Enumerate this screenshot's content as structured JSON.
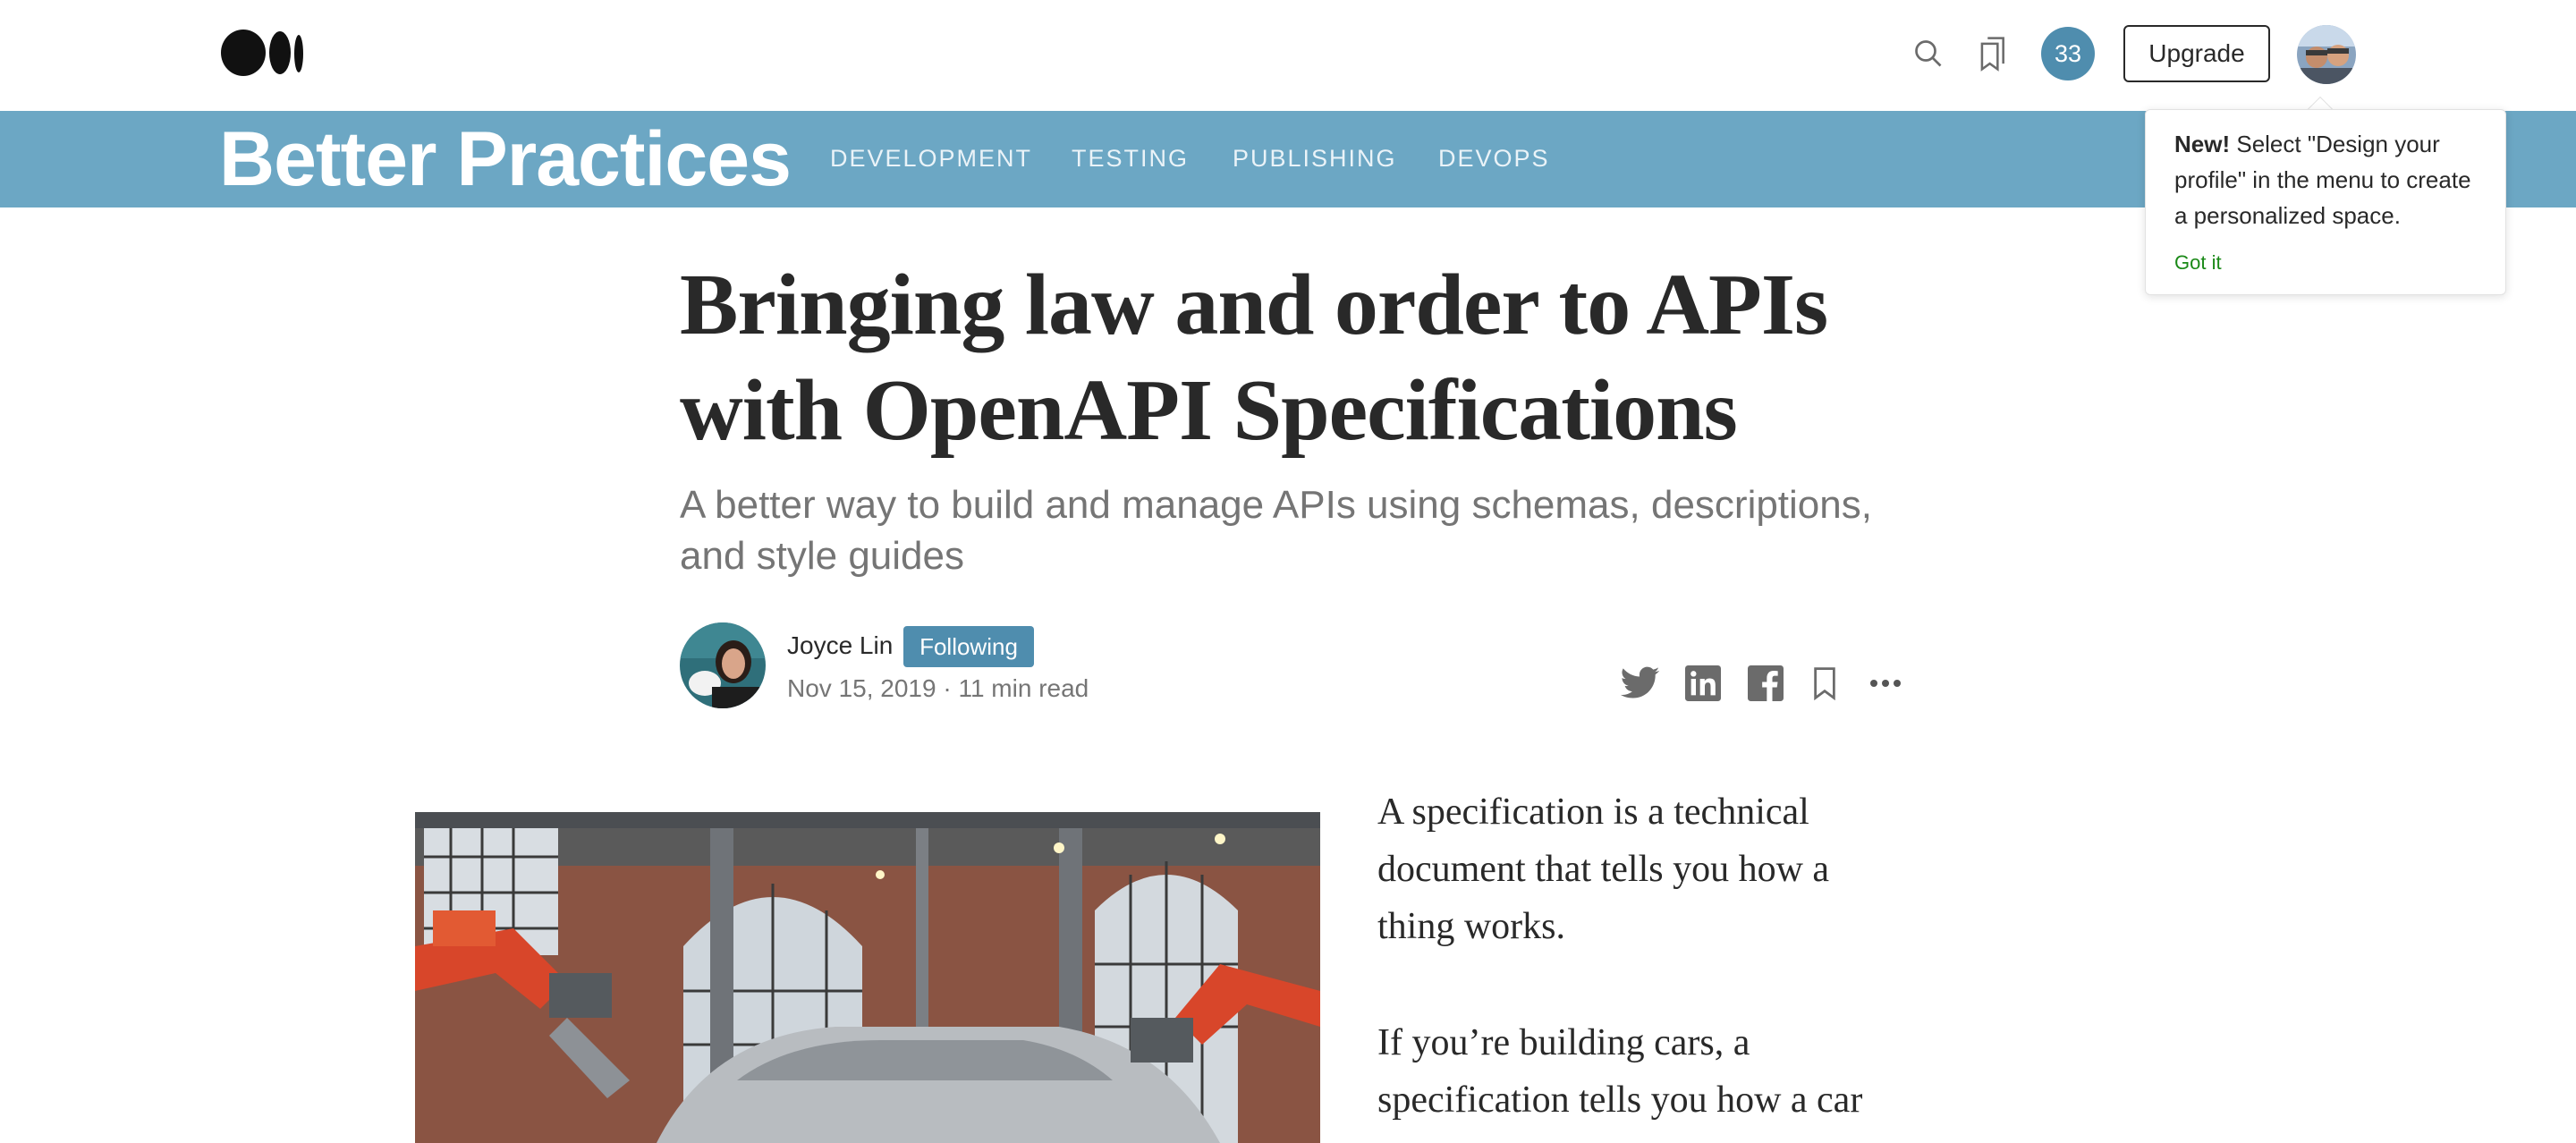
{
  "topbar": {
    "logo": "medium-logo",
    "search_icon": "search-icon",
    "lists_icon": "bookmarks-icon",
    "notification_count": "33",
    "upgrade_label": "Upgrade",
    "avatar": "user-avatar"
  },
  "publication": {
    "name": "Better Practices",
    "nav": [
      "DEVELOPMENT",
      "TESTING",
      "PUBLISHING",
      "DEVOPS"
    ]
  },
  "tooltip": {
    "new_label": "New!",
    "text": " Select \"Design your profile\" in the menu to create a personalized space.",
    "got_it": "Got it"
  },
  "article": {
    "title": "Bringing law and order to APIs with OpenAPI Specifications",
    "subtitle": "A better way to build and manage APIs using schemas, descriptions, and style guides",
    "author": "Joyce Lin",
    "follow_state": "Following",
    "meta": "Nov 15, 2019 · 11 min read",
    "share_icons": [
      "twitter-icon",
      "linkedin-icon",
      "facebook-icon",
      "bookmark-icon",
      "more-icon"
    ],
    "paragraphs": [
      "A specification is a technical document that tells you how a thing works.",
      "If you’re building cars, a specification tells you how a car"
    ]
  },
  "colors": {
    "publication_bar": "#6ca7c4",
    "accent": "#4f8dae",
    "got_it": "#1a8917"
  }
}
